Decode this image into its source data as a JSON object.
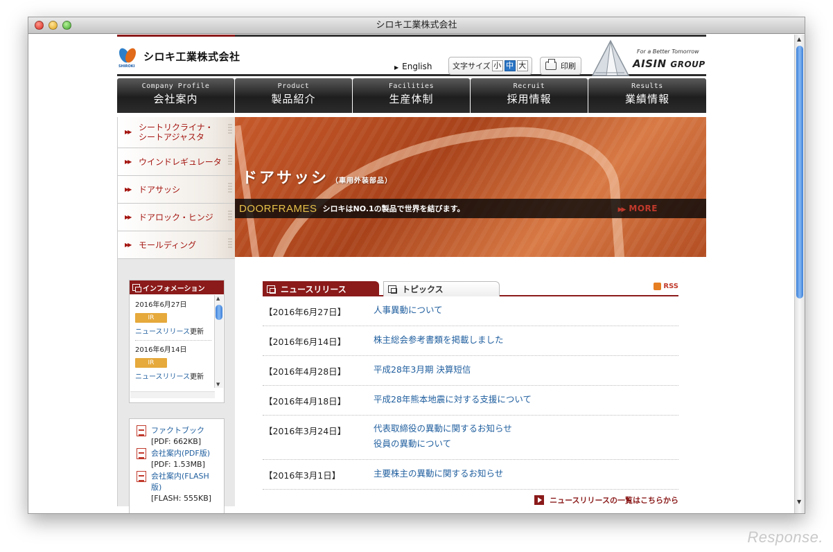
{
  "window": {
    "title": "シロキ工業株式会社"
  },
  "header": {
    "logo_text": "シロキ工業株式会社",
    "logo_sub": "SHIROKI",
    "english_link": "English",
    "font_size_label": "文字サイズ",
    "font_sizes": [
      "小",
      "中",
      "大"
    ],
    "font_size_selected": "中",
    "print_label": "印刷",
    "aisin_tagline": "For a Better Tomorrow",
    "aisin_name": "AISIN",
    "aisin_group": "GROUP"
  },
  "nav": [
    {
      "en": "Company Profile",
      "jp": "会社案内"
    },
    {
      "en": "Product",
      "jp": "製品紹介"
    },
    {
      "en": "Facilities",
      "jp": "生産体制"
    },
    {
      "en": "Recruit",
      "jp": "採用情報"
    },
    {
      "en": "Results",
      "jp": "業績情報"
    }
  ],
  "product_menu": [
    {
      "line1": "シートリクライナ・",
      "line2": "シートアジャスタ"
    },
    {
      "line1": "ウインドレギュレータ",
      "line2": ""
    },
    {
      "line1": "ドアサッシ",
      "line2": ""
    },
    {
      "line1": "ドアロック・ヒンジ",
      "line2": ""
    },
    {
      "line1": "モールディング",
      "line2": ""
    }
  ],
  "hero": {
    "title": "ドアサッシ",
    "subtitle": "（車用外装部品）",
    "bar_en": "DOORFRAMES",
    "bar_tagline": "シロキはNO.1の製品で世界を結びます。",
    "more": "MORE"
  },
  "info": {
    "heading": "インフォメーション",
    "items": [
      {
        "date": "2016年6月27日",
        "badge": "IR",
        "link": "ニュースリリース",
        "suffix": "更新"
      },
      {
        "date": "2016年6月14日",
        "badge": "IR",
        "link": "ニュースリリース",
        "suffix": "更新"
      }
    ]
  },
  "downloads": [
    {
      "label": "ファクトブック",
      "size": "[PDF: 662KB]"
    },
    {
      "label": "会社案内(PDF版)",
      "size": "[PDF: 1.53MB]"
    },
    {
      "label": "会社案内(FLASH版)",
      "size": "[FLASH: 555KB]"
    }
  ],
  "news": {
    "tabs": [
      "ニュースリリース",
      "トピックス"
    ],
    "active_tab": "ニュースリリース",
    "rss": "RSS",
    "rows": [
      {
        "date": "【2016年6月27日】",
        "title": "人事異動について",
        "title2": ""
      },
      {
        "date": "【2016年6月14日】",
        "title": "株主総会参考書類を掲載しました",
        "title2": ""
      },
      {
        "date": "【2016年4月28日】",
        "title": "平成28年3月期 決算短信",
        "title2": ""
      },
      {
        "date": "【2016年4月18日】",
        "title": "平成28年熊本地震に対する支援について",
        "title2": ""
      },
      {
        "date": "【2016年3月24日】",
        "title": "代表取締役の異動に関するお知らせ",
        "title2": "役員の異動について"
      },
      {
        "date": "【2016年3月1日】",
        "title": "主要株主の異動に関するお知らせ",
        "title2": ""
      }
    ],
    "more_link": "ニュースリリースの一覧はこちらから"
  },
  "watermark": "Response."
}
